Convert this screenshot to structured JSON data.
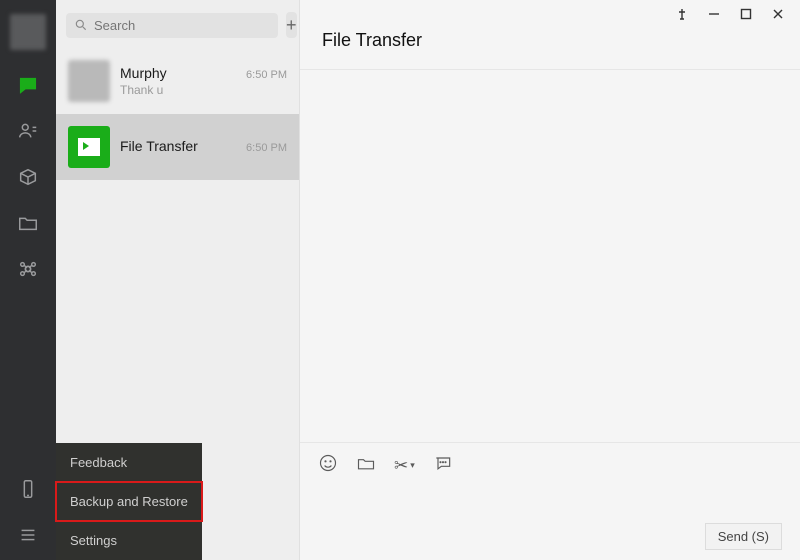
{
  "window_controls": {
    "pin": "⚲",
    "minimize": "–",
    "maximize": "□",
    "close": "×"
  },
  "search": {
    "placeholder": "Search"
  },
  "chats": [
    {
      "name": "Murphy",
      "preview": "Thank u",
      "time": "6:50 PM"
    },
    {
      "name": "File Transfer",
      "preview": "",
      "time": "6:50 PM"
    }
  ],
  "header": {
    "title": "File Transfer"
  },
  "popup": {
    "items": [
      "Feedback",
      "Backup and Restore",
      "Settings"
    ],
    "highlight_index": 1
  },
  "composer": {
    "send_label": "Send (S)"
  },
  "icons": {
    "add": "+"
  }
}
